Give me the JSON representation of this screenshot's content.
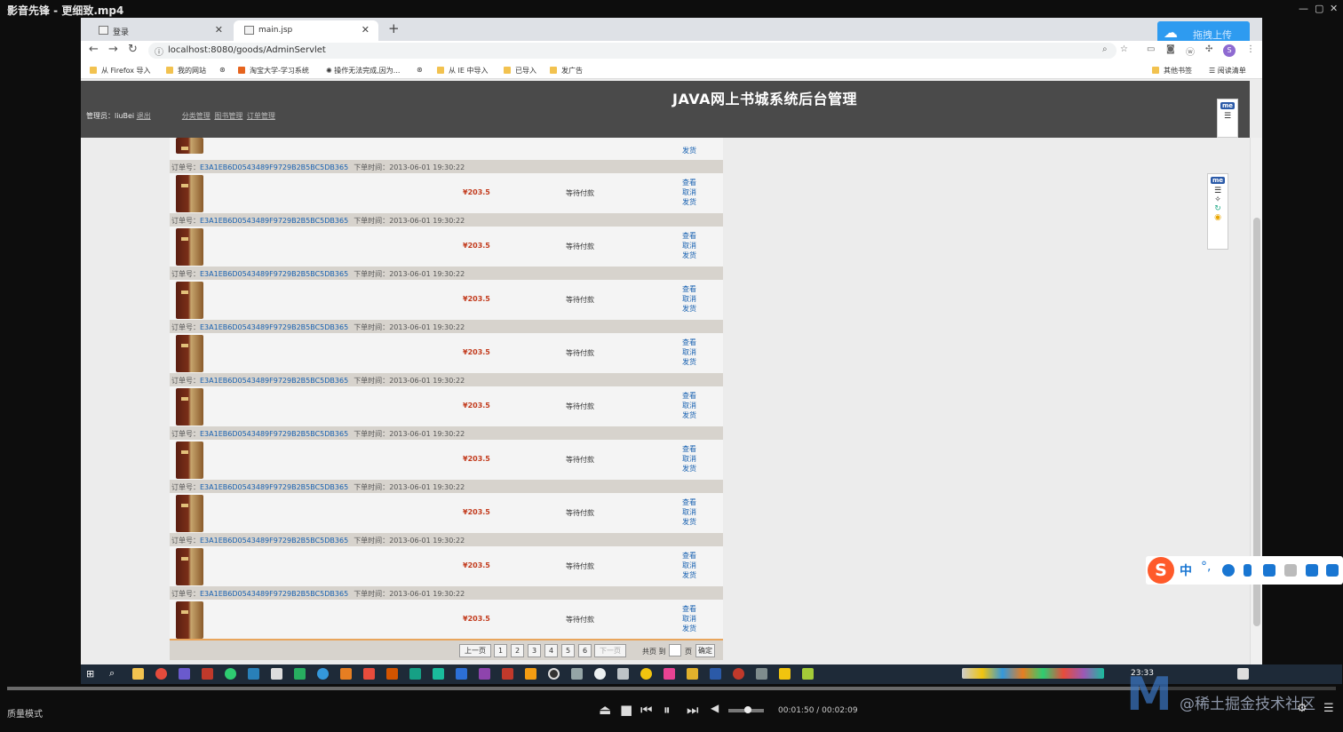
{
  "player": {
    "title": "影音先锋 - 更细致.mp4",
    "quality_mode": "质量模式",
    "timecode": "00:01:50 / 00:02:09",
    "progress": 0.852,
    "volume": 0.55,
    "watermark": "@稀土掘金技术社区"
  },
  "browser": {
    "tabs": [
      {
        "title": "登录",
        "active": false
      },
      {
        "title": "main.jsp",
        "active": true
      }
    ],
    "upload_button": "拖拽上传",
    "url": "localhost:8080/goods/AdminServlet",
    "bookmarks": [
      "从 Firefox 导入",
      "我的网站",
      "淘宝大学-学习系统",
      "操作无法完成,因为...",
      "从 IE 中导入",
      "已导入",
      "发广告"
    ],
    "bookmarks_right": [
      "其他书签",
      "阅读清单"
    ],
    "profile_initial": "S"
  },
  "app": {
    "title": "JAVA网上书城系统后台管理",
    "admin_label": "管理员：",
    "admin_name": "liuBei",
    "logout": "退出",
    "nav": [
      "分类管理",
      "图书管理",
      "订单管理"
    ]
  },
  "orders": {
    "order_no_label": "订单号：",
    "time_label": "下单时间：",
    "actions": [
      "查看",
      "取消",
      "发货"
    ],
    "first_partial_action": "发货",
    "rows": [
      {
        "id": "E3A1EB6D0543489F9729B2B5BC5DB365",
        "time": "2013-06-01 19:30:22",
        "price": "¥203.5",
        "status": "等待付款"
      },
      {
        "id": "E3A1EB6D0543489F9729B2B5BC5DB365",
        "time": "2013-06-01 19:30:22",
        "price": "¥203.5",
        "status": "等待付款"
      },
      {
        "id": "E3A1EB6D0543489F9729B2B5BC5DB365",
        "time": "2013-06-01 19:30:22",
        "price": "¥203.5",
        "status": "等待付款"
      },
      {
        "id": "E3A1EB6D0543489F9729B2B5BC5DB365",
        "time": "2013-06-01 19:30:22",
        "price": "¥203.5",
        "status": "等待付款"
      },
      {
        "id": "E3A1EB6D0543489F9729B2B5BC5DB365",
        "time": "2013-06-01 19:30:22",
        "price": "¥203.5",
        "status": "等待付款"
      },
      {
        "id": "E3A1EB6D0543489F9729B2B5BC5DB365",
        "time": "2013-06-01 19:30:22",
        "price": "¥203.5",
        "status": "等待付款"
      },
      {
        "id": "E3A1EB6D0543489F9729B2B5BC5DB365",
        "time": "2013-06-01 19:30:22",
        "price": "¥203.5",
        "status": "等待付款"
      },
      {
        "id": "E3A1EB6D0543489F9729B2B5BC5DB365",
        "time": "2013-06-01 19:30:22",
        "price": "¥203.5",
        "status": "等待付款"
      },
      {
        "id": "E3A1EB6D0543489F9729B2B5BC5DB365",
        "time": "2013-06-01 19:30:22",
        "price": "¥203.5",
        "status": "等待付款"
      }
    ]
  },
  "pager": {
    "prev": "上一页",
    "pages": [
      "1",
      "2",
      "3",
      "4",
      "5",
      "6"
    ],
    "next": "下一页",
    "jump_prefix": "共页 到",
    "page_suffix": "页",
    "confirm": "确定"
  },
  "taskbar": {
    "clock": "23:33"
  },
  "ime": {
    "mode": "中",
    "punct": "°,"
  },
  "colors": {
    "link": "#1761b1",
    "price": "#c23a1c",
    "header_bg": "#4a4a4a",
    "order_head_bg": "#d7d3cd"
  }
}
